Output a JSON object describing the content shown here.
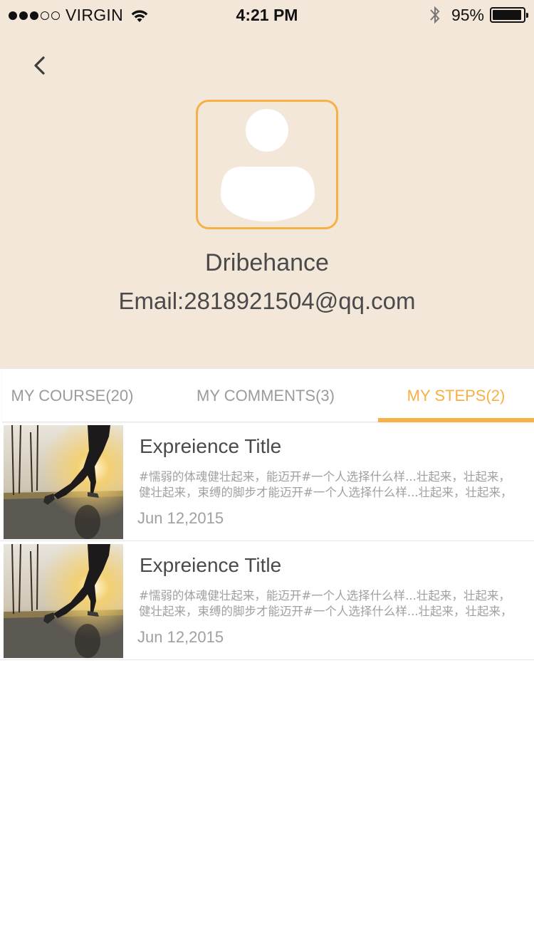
{
  "status_bar": {
    "carrier": "VIRGIN",
    "signal_bars_filled": 3,
    "signal_bars_total": 5,
    "time": "4:21 PM",
    "battery_percent": "95%",
    "battery_level": 0.95
  },
  "profile": {
    "name": "Dribehance",
    "email": "Email:2818921504@qq.com"
  },
  "tabs": [
    {
      "label": "MY COURSE(20)",
      "active": false
    },
    {
      "label": "MY COMMENTS(3)",
      "active": false
    },
    {
      "label": "MY STEPS(2)",
      "active": true
    }
  ],
  "items": [
    {
      "title": "Expreience Title",
      "desc_line1": "#懦弱的体魂健壮起来，能迈开#一个人选择什么样...壮起来，壮起来，",
      "desc_line2": "健壮起来，束缚的脚步才能迈开#一个人选择什么样...壮起来，壮起来，",
      "date": "Jun 12,2015"
    },
    {
      "title": "Expreience Title",
      "desc_line1": "#懦弱的体魂健壮起来，能迈开#一个人选择什么样...壮起来，壮起来，",
      "desc_line2": "健壮起来，束缚的脚步才能迈开#一个人选择什么样...壮起来，壮起来，",
      "date": "Jun 12,2015"
    }
  ],
  "colors": {
    "header_bg": "#f3e7da",
    "accent": "#f7b044",
    "text_dark": "#4a4a4a",
    "text_muted": "#a0a0a0"
  }
}
